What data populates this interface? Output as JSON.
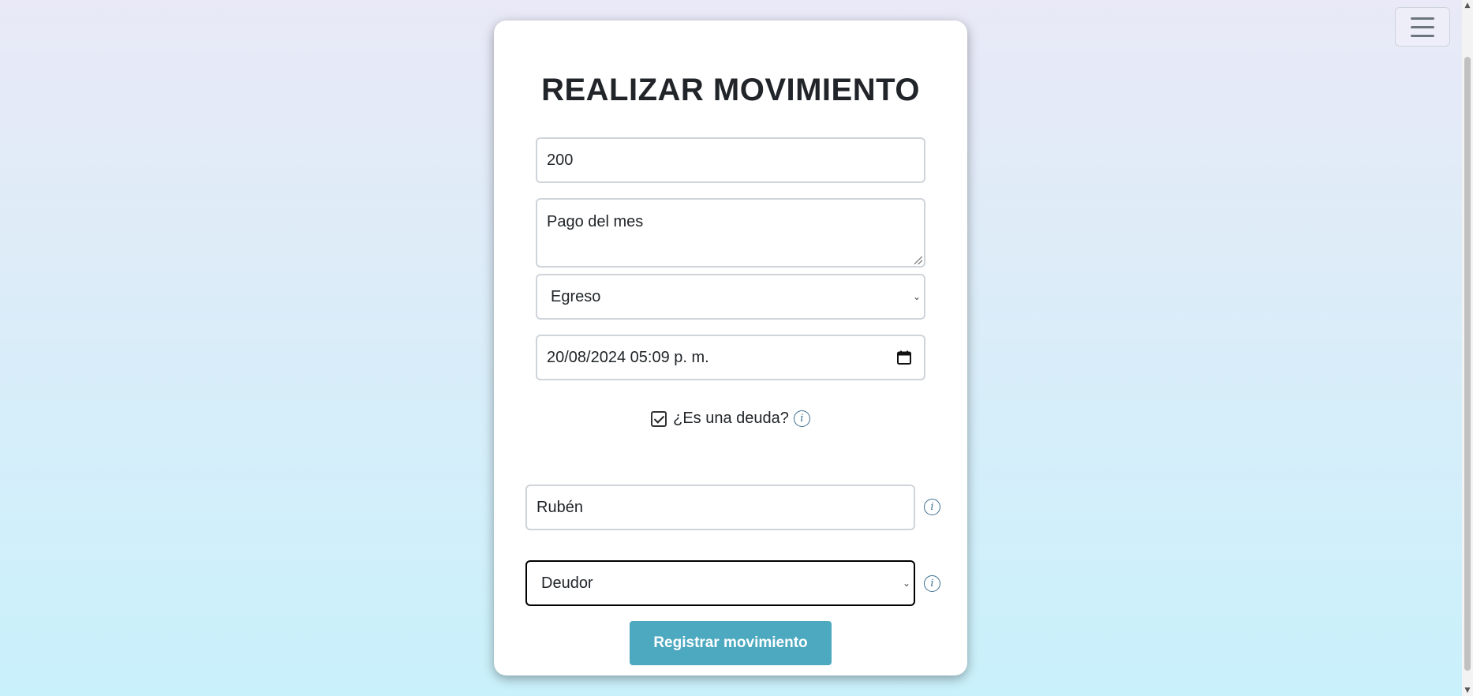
{
  "form": {
    "title": "REALIZAR MOVIMIENTO",
    "amount_value": "200",
    "concept_value": "Pago del mes",
    "type_selected": "Egreso",
    "datetime_value": "20/08/2024 05:09 p. m.",
    "is_debt_label": "¿Es una deuda?",
    "is_debt_checked": true,
    "person_value": "Rubén",
    "role_selected": "Deudor",
    "submit_label": "Registrar movimiento"
  },
  "icons": {
    "info": "i",
    "chevron": "⌄"
  },
  "colors": {
    "primary_button": "#4ca9bf",
    "info_icon": "#3b6e8f"
  }
}
